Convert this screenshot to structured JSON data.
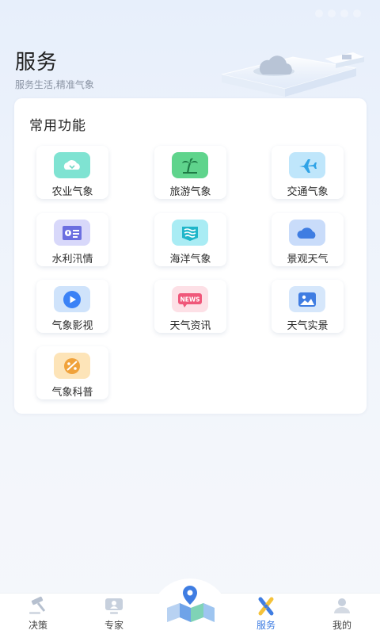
{
  "page": {
    "title": "服务",
    "subtitle": "服务生活,精准气象"
  },
  "section": {
    "title": "常用功能"
  },
  "functions": [
    {
      "label": "农业气象",
      "icon": "agriculture-cloud-icon",
      "bg": "#7fe3d2",
      "fg": "#ffffff"
    },
    {
      "label": "旅游气象",
      "icon": "palm-tree-icon",
      "bg": "#5fd48c",
      "fg": "#1e7a45"
    },
    {
      "label": "交通气象",
      "icon": "airplane-icon",
      "bg": "#bfe6fb",
      "fg": "#2fa3e6"
    },
    {
      "label": "水利汛情",
      "icon": "water-report-icon",
      "bg": "#d8d8fa",
      "fg": "#6b6fe0"
    },
    {
      "label": "海洋气象",
      "icon": "ocean-waves-icon",
      "bg": "#a9ecf4",
      "fg": "#1fb6c9"
    },
    {
      "label": "景观天气",
      "icon": "cloud-icon",
      "bg": "#c9dcfa",
      "fg": "#3f7de2"
    },
    {
      "label": "气象影视",
      "icon": "video-play-icon",
      "bg": "#cfe3fb",
      "fg": "#3b82f6"
    },
    {
      "label": "天气资讯",
      "icon": "news-icon",
      "bg": "#fde0e6",
      "fg": "#f0577a",
      "badge": "NEWS"
    },
    {
      "label": "天气实景",
      "icon": "photo-icon",
      "bg": "#d6e7fb",
      "fg": "#3f7de2"
    },
    {
      "label": "气象科普",
      "icon": "palette-science-icon",
      "bg": "#fde4b8",
      "fg": "#f0a23b"
    }
  ],
  "nav": {
    "items": [
      {
        "label": "决策",
        "icon": "gavel-icon"
      },
      {
        "label": "专家",
        "icon": "expert-monitor-icon"
      },
      {
        "label": "服务",
        "icon": "services-icon",
        "active": true
      },
      {
        "label": "我的",
        "icon": "user-icon"
      }
    ],
    "center_icon": "map-location-icon"
  },
  "colors": {
    "accent": "#3f7de2",
    "background": "#eef3fb"
  }
}
